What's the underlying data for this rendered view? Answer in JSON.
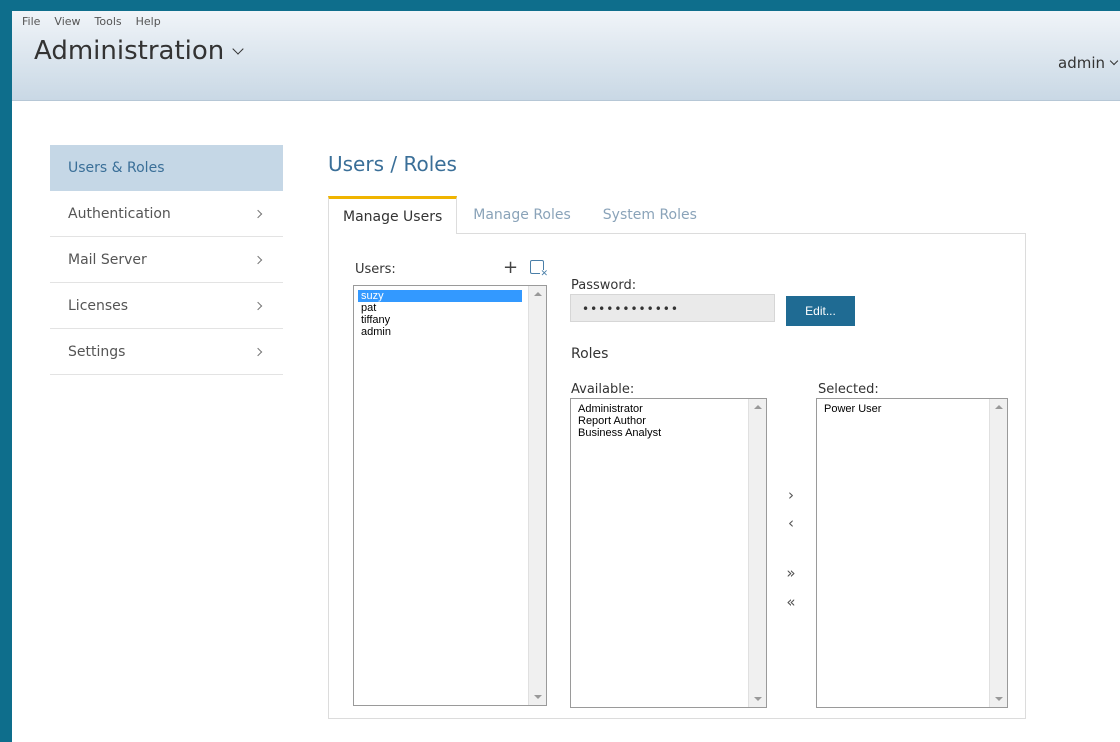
{
  "menu": {
    "items": [
      "File",
      "View",
      "Tools",
      "Help"
    ]
  },
  "header": {
    "title": "Administration",
    "user": "admin"
  },
  "sidebar": {
    "items": [
      {
        "label": "Users & Roles"
      },
      {
        "label": "Authentication"
      },
      {
        "label": "Mail Server"
      },
      {
        "label": "Licenses"
      },
      {
        "label": "Settings"
      }
    ]
  },
  "page": {
    "title": "Users / Roles"
  },
  "tabs": [
    {
      "label": "Manage Users"
    },
    {
      "label": "Manage Roles"
    },
    {
      "label": "System Roles"
    }
  ],
  "users": {
    "label": "Users:",
    "list": [
      "suzy",
      "pat",
      "tiffany",
      "admin"
    ],
    "selected": "suzy"
  },
  "password": {
    "label": "Password:",
    "value": "••••••••••••",
    "edit_label": "Edit..."
  },
  "roles": {
    "heading": "Roles",
    "available_label": "Available:",
    "available": [
      "Administrator",
      "Report Author",
      "Business Analyst"
    ],
    "selected_label": "Selected:",
    "selected": [
      "Power User"
    ]
  },
  "move_buttons": {
    "add": "›",
    "remove": "‹",
    "add_all": "»",
    "remove_all": "«"
  },
  "icons": {
    "add_user": "plus-icon",
    "delete_user": "delete-user-icon"
  }
}
